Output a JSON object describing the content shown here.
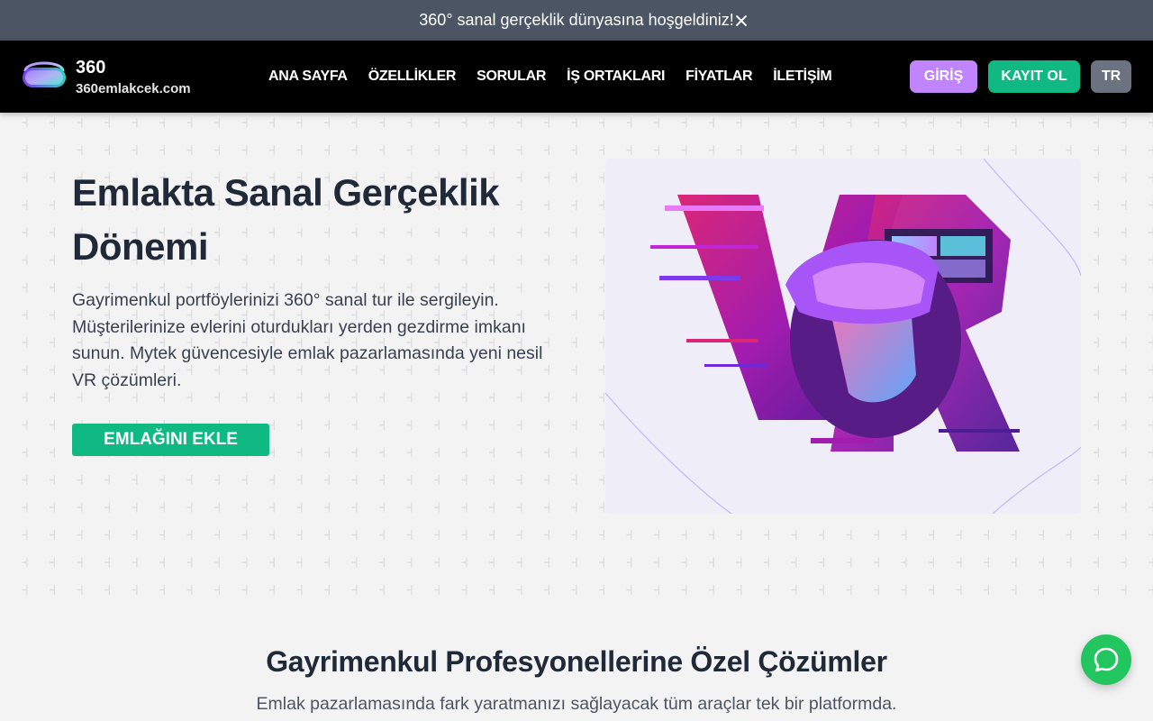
{
  "announcement": {
    "text": "360° sanal gerçeklik dünyasına hoşgeldiniz!"
  },
  "logo": {
    "title": "360",
    "domain": "360emlakcek.com"
  },
  "nav": {
    "items": [
      {
        "label": "ANA SAYFA"
      },
      {
        "label": "ÖZELLİKLER"
      },
      {
        "label": "SORULAR"
      },
      {
        "label": "İŞ ORTAKLARI"
      },
      {
        "label": "FİYATLAR"
      },
      {
        "label": "İLETİŞİM"
      }
    ],
    "login_label": "GİRİŞ",
    "register_label": "KAYIT OL",
    "lang_label": "TR"
  },
  "hero": {
    "title": "Emlakta Sanal Gerçeklik Dönemi",
    "text": "Gayrimenkul portföylerinizi 360° sanal tur ile sergileyin. Müşterilerinize evlerini oturdukları yerden gezdirme imkanı sunun. Mytek güvencesiyle emlak pazarlamasında yeni nesil VR çözümleri.",
    "cta_label": "EMLAĞINI EKLE"
  },
  "solutions": {
    "title": "Gayrimenkul Profesyonellerine Özel Çözümler",
    "subtitle": "Emlak pazarlamasında fark yaratmanızı sağlayacak tüm araçlar tek bir platformda."
  },
  "colors": {
    "announce_bg": "#4b5563",
    "nav_bg": "#000000",
    "accent_green": "#10b981",
    "accent_purple": "#c084fc",
    "lang_gray": "#6b7280",
    "chat_green": "#22c55e"
  },
  "icons": {
    "close": "close-icon",
    "logo": "vr-headset-logo-icon",
    "chat": "chat-bubble-icon"
  }
}
